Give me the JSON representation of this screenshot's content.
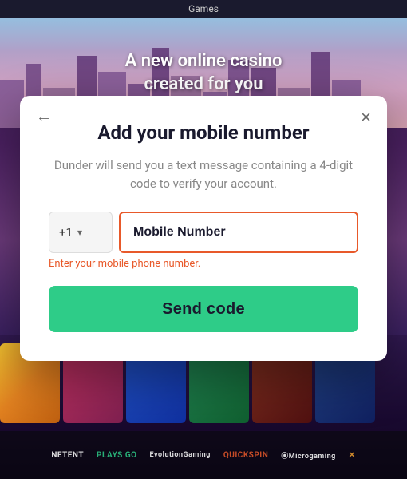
{
  "topBar": {
    "title": "Games"
  },
  "hero": {
    "line1": "A new online casino",
    "line2": "created for you"
  },
  "modal": {
    "title": "Add your mobile number",
    "description": "Dunder will send you a text message containing a 4-digit code to verify your account.",
    "countryCode": "+1",
    "phoneFieldPlaceholder": "Mobile Number",
    "errorText": "Enter your mobile phone number.",
    "sendCodeLabel": "Send code",
    "backArrow": "←",
    "closeX": "×"
  },
  "providers": [
    {
      "name": "NETENT",
      "style": "normal"
    },
    {
      "name": "PLAYS GO",
      "style": "green"
    },
    {
      "name": "EvolutionGaming",
      "style": "normal"
    },
    {
      "name": "QUICKSPIN",
      "style": "red"
    },
    {
      "name": "Microgaming",
      "style": "normal"
    },
    {
      "name": "X",
      "style": "orange"
    }
  ]
}
